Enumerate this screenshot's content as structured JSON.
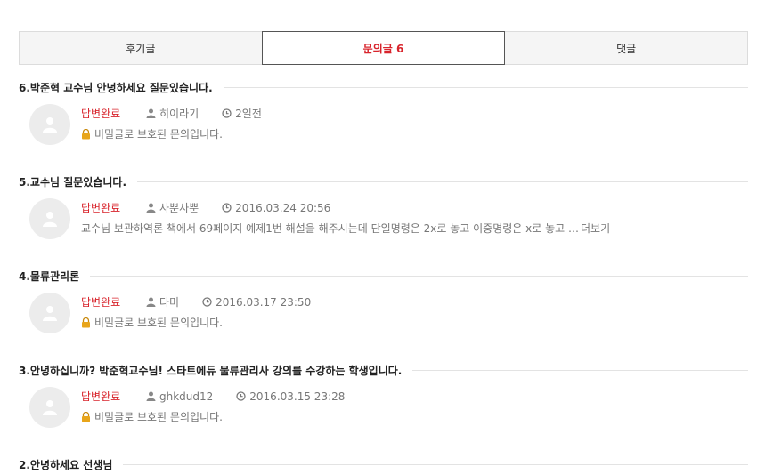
{
  "tabs": [
    {
      "label": "후기글"
    },
    {
      "label": "문의글 6"
    },
    {
      "label": "댓글"
    }
  ],
  "items": [
    {
      "title": "6.박준혁 교수님 안녕하세요 질문있습니다.",
      "status": "답변완료",
      "author": "히이라기",
      "date": "2일전",
      "content": "비밀글로 보호된 문의입니다.",
      "locked": true
    },
    {
      "title": "5.교수님 질문있습니다.",
      "status": "답변완료",
      "author": "사뿐사뿐",
      "date": "2016.03.24 20:56",
      "content": "교수님 보관하역론 책에서 69페이지 예제1번 해설을 해주시는데 단일명령은 2x로 놓고 이중명령은 x로 놓고 …",
      "more": "더보기",
      "locked": false
    },
    {
      "title": "4.물류관리론",
      "status": "답변완료",
      "author": "다미",
      "date": "2016.03.17 23:50",
      "content": "비밀글로 보호된 문의입니다.",
      "locked": true
    },
    {
      "title": "3.안녕하십니까? 박준혁교수님! 스타트에듀 물류관리사 강의를 수강하는 학생입니다.",
      "status": "답변완료",
      "author": "ghkdud12",
      "date": "2016.03.15 23:28",
      "content": "비밀글로 보호된 문의입니다.",
      "locked": true
    },
    {
      "title": "2.안녕하세요 선생님"
    }
  ],
  "colors": {
    "accent": "#d8242c",
    "lock": "#e8a51a"
  }
}
